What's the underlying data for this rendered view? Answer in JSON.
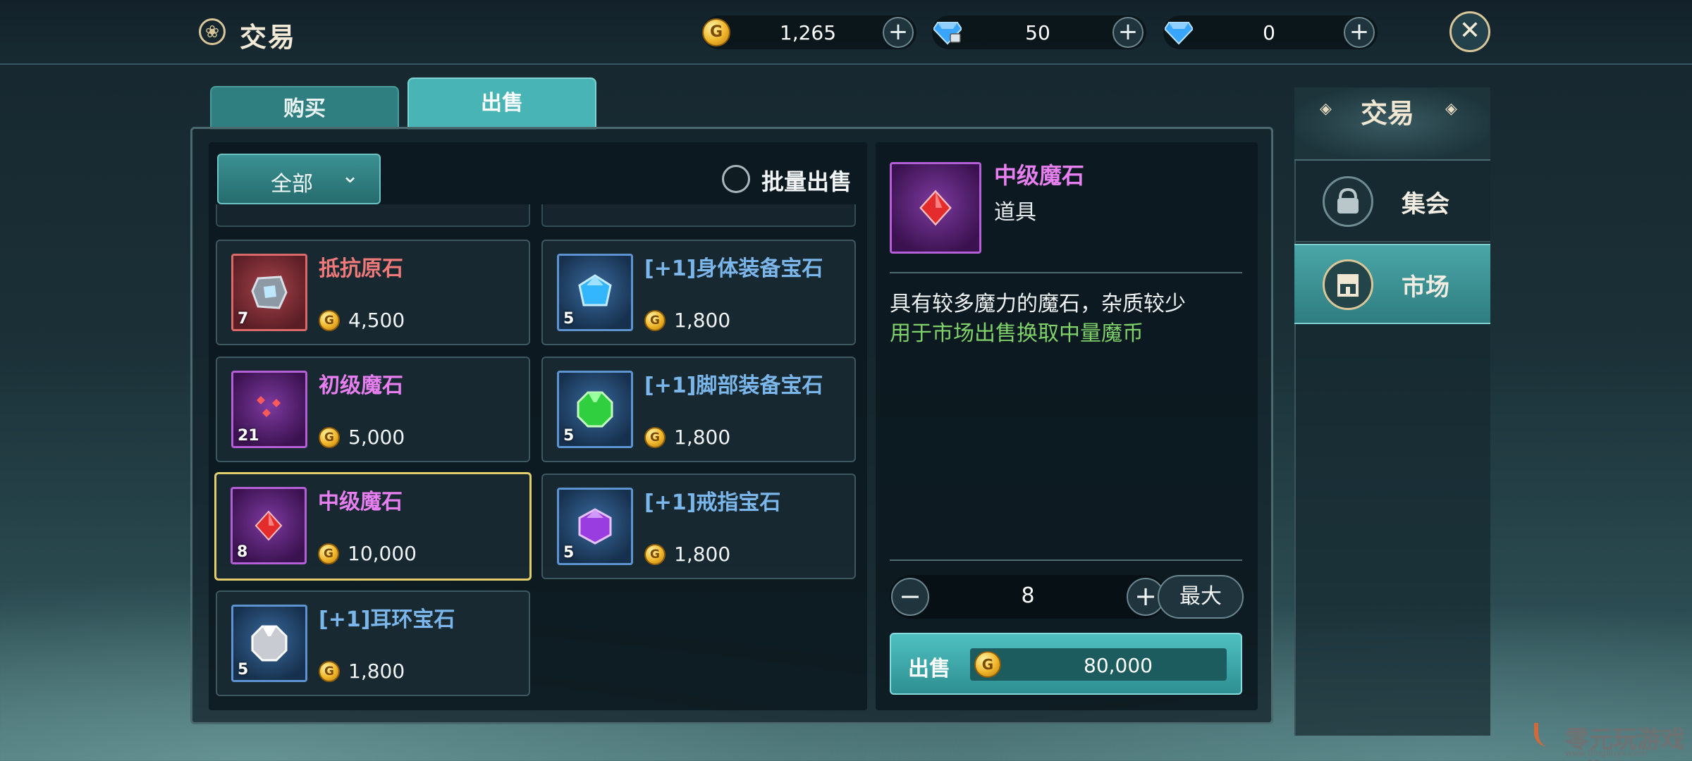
{
  "header": {
    "title": "交易",
    "currencies": [
      {
        "name": "gold",
        "value": "1,265"
      },
      {
        "name": "locked-diamond",
        "value": "50"
      },
      {
        "name": "diamond",
        "value": "0"
      }
    ],
    "plus_label": "+",
    "close_label": "✕"
  },
  "tabs": [
    {
      "label": "购买",
      "active": false
    },
    {
      "label": "出售",
      "active": true
    }
  ],
  "filter": {
    "label": "全部"
  },
  "batch": {
    "label": "批量出售"
  },
  "items": [
    {
      "name": "抵抗原石",
      "qty": "7",
      "price": "4,500",
      "rarity": "red"
    },
    {
      "name": "[+1]身体装备宝石",
      "qty": "5",
      "price": "1,800",
      "rarity": "blue"
    },
    {
      "name": "初级魔石",
      "qty": "21",
      "price": "5,000",
      "rarity": "purple"
    },
    {
      "name": "[+1]脚部装备宝石",
      "qty": "5",
      "price": "1,800",
      "rarity": "blue"
    },
    {
      "name": "中级魔石",
      "qty": "8",
      "price": "10,000",
      "rarity": "purple",
      "selected": true
    },
    {
      "name": "[+1]戒指宝石",
      "qty": "5",
      "price": "1,800",
      "rarity": "blue"
    },
    {
      "name": "[+1]耳环宝石",
      "qty": "5",
      "price": "1,800",
      "rarity": "blue"
    }
  ],
  "detail": {
    "name": "中级魔石",
    "type": "道具",
    "desc_line1": "具有较多魔力的魔石，杂质较少",
    "desc_line2": "用于市场出售换取中量魔币",
    "quantity": "8",
    "minus_label": "−",
    "plus_label": "+",
    "max_label": "最大",
    "sell_label": "出售",
    "sell_total": "80,000"
  },
  "sidebar": {
    "title": "交易",
    "items": [
      {
        "label": "集会",
        "active": false
      },
      {
        "label": "市场",
        "active": true
      }
    ]
  },
  "watermark": {
    "text": "零元玩游戏",
    "url": "www.0ingliuyx.com  www.06zyx.com"
  },
  "colors": {
    "accent_teal": "#49b4b6",
    "selected_border": "#e3cc6b",
    "name_red": "#f07a7a",
    "name_purple": "#e77ff0",
    "name_blue": "#7ab6ea",
    "desc_green": "#7fd16a"
  }
}
